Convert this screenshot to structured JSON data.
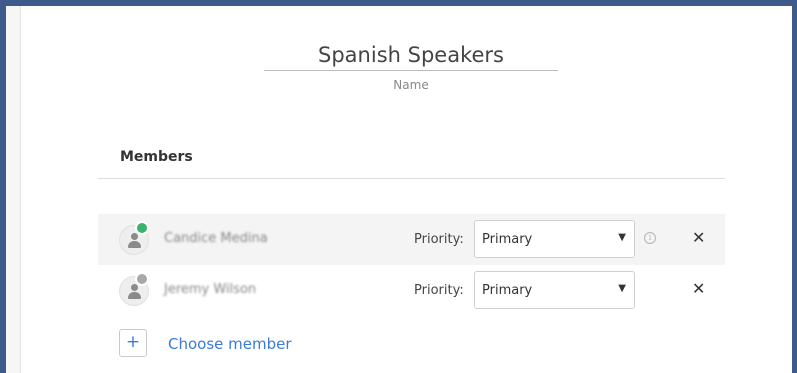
{
  "group": {
    "name_value": "Spanish Speakers",
    "name_label": "Name"
  },
  "members_section": {
    "title": "Members",
    "priority_label": "Priority:",
    "members": [
      {
        "name": "Candice Medina",
        "priority": "Primary",
        "status": "online",
        "status_color": "#3bb36b",
        "has_info": true
      },
      {
        "name": "Jeremy Wilson",
        "priority": "Primary",
        "status": "offline",
        "status_color": "#a8a8a8",
        "has_info": false
      }
    ],
    "add_button_symbol": "+",
    "choose_member_label": "Choose member"
  },
  "icons": {
    "info": "i",
    "remove": "✕",
    "caret": "▼"
  },
  "colors": {
    "frame": "#3d5a8a",
    "link": "#3a7bd5",
    "online": "#3bb36b"
  }
}
